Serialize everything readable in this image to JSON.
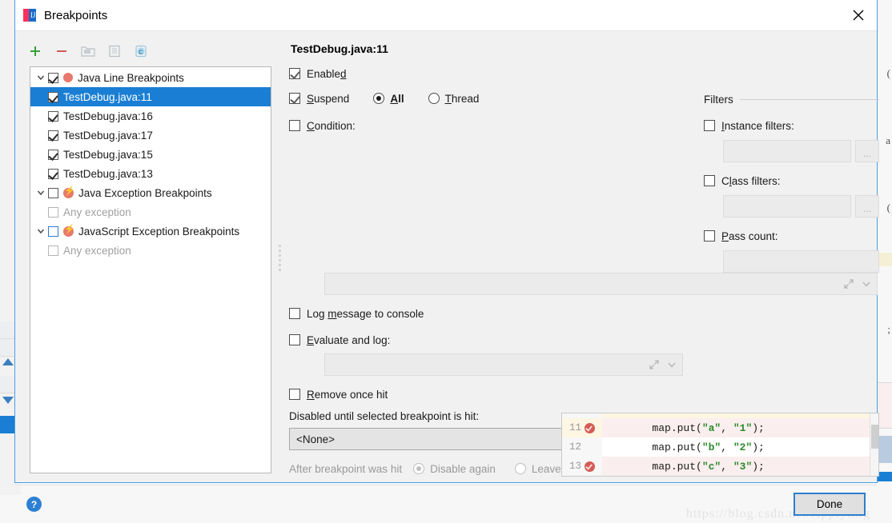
{
  "window": {
    "title": "Breakpoints",
    "app_icon": "intellij-idea-icon",
    "close_icon": "close-icon"
  },
  "toolbar": {
    "add_label": "+",
    "remove_label": "−",
    "items": [
      {
        "name": "add-breakpoint-button",
        "icon": "plus-icon",
        "enabled": true
      },
      {
        "name": "remove-breakpoint-button",
        "icon": "minus-icon",
        "enabled": true
      },
      {
        "name": "group-by-file-button",
        "icon": "folder-icon",
        "enabled": false
      },
      {
        "name": "group-by-type-button",
        "icon": "document-icon",
        "enabled": false
      },
      {
        "name": "group-by-class-button",
        "icon": "class-c-icon",
        "enabled": false
      }
    ]
  },
  "tree": {
    "nodes": [
      {
        "label": "Java Line Breakpoints",
        "level": 0,
        "checked": true,
        "icon": "breakpoint-dot-icon",
        "twisty": "expanded",
        "selected": false,
        "dim": false
      },
      {
        "label": "TestDebug.java:11",
        "level": 1,
        "checked": true,
        "icon": "none",
        "twisty": "none",
        "selected": true,
        "dim": false
      },
      {
        "label": "TestDebug.java:16",
        "level": 1,
        "checked": true,
        "icon": "none",
        "twisty": "none",
        "selected": false,
        "dim": false
      },
      {
        "label": "TestDebug.java:17",
        "level": 1,
        "checked": true,
        "icon": "none",
        "twisty": "none",
        "selected": false,
        "dim": false
      },
      {
        "label": "TestDebug.java:15",
        "level": 1,
        "checked": true,
        "icon": "none",
        "twisty": "none",
        "selected": false,
        "dim": false
      },
      {
        "label": "TestDebug.java:13",
        "level": 1,
        "checked": true,
        "icon": "none",
        "twisty": "none",
        "selected": false,
        "dim": false
      },
      {
        "label": "Java Exception Breakpoints",
        "level": 0,
        "checked": false,
        "icon": "exception-bolt-icon",
        "twisty": "expanded",
        "selected": false,
        "dim": false
      },
      {
        "label": "Any exception",
        "level": 1,
        "checked": false,
        "icon": "none",
        "twisty": "none",
        "selected": false,
        "dim": true
      },
      {
        "label": "JavaScript Exception Breakpoints",
        "level": 0,
        "checked": false,
        "icon": "exception-bolt-icon",
        "twisty": "expanded",
        "selected": false,
        "dim": false
      },
      {
        "label": "Any exception",
        "level": 1,
        "checked": false,
        "icon": "none",
        "twisty": "none",
        "selected": false,
        "dim": true
      }
    ]
  },
  "detail": {
    "title": "TestDebug.java:11",
    "enabled": {
      "label": "Enabled",
      "mnemonic": "d",
      "checked": true
    },
    "suspend": {
      "label": "Suspend",
      "mnemonic": "S",
      "checked": true
    },
    "suspend_all": {
      "label": "All",
      "mnemonic": "A",
      "selected": true
    },
    "suspend_thread": {
      "label": "Thread",
      "mnemonic": "T",
      "selected": false
    },
    "condition": {
      "label": "Condition:",
      "mnemonic": "C",
      "checked": false,
      "value": "",
      "expand_icon": "expand-icon",
      "dropdown_icon": "chevron-down-icon"
    },
    "log_message": {
      "label": "Log message to console",
      "mnemonic": "m",
      "checked": false
    },
    "evaluate_and_log": {
      "label": "Evaluate and log:",
      "mnemonic": "E",
      "checked": false,
      "value": "",
      "expand_icon": "expand-icon",
      "dropdown_icon": "chevron-down-icon"
    },
    "remove_once_hit": {
      "label": "Remove once hit",
      "mnemonic": "R",
      "checked": false
    },
    "disabled_until": {
      "label": "Disabled until selected breakpoint is hit:",
      "value": "<None>",
      "dropdown_icon": "chevron-down-icon"
    },
    "after_hit": {
      "label": "After breakpoint was hit",
      "disable_again": {
        "label": "Disable again",
        "selected": true
      },
      "leave_enabled": {
        "label": "Leave enabled",
        "selected": false
      }
    }
  },
  "filters": {
    "legend": "Filters",
    "instance": {
      "label": "Instance filters:",
      "mnemonic": "I",
      "checked": false,
      "value": "",
      "browse_label": "..."
    },
    "class": {
      "label": "Class filters:",
      "mnemonic": "l",
      "checked": false,
      "value": "",
      "browse_label": "..."
    },
    "pass_count": {
      "label": "Pass count:",
      "mnemonic": "P",
      "checked": false,
      "value": ""
    }
  },
  "code_preview": {
    "lines": [
      {
        "number": "11",
        "has_breakpoint": true,
        "highlighted": true,
        "current": true,
        "code": "        map.put(",
        "str1": "\"a\"",
        "mid": ", ",
        "str2": "\"1\"",
        "tail": ");"
      },
      {
        "number": "12",
        "has_breakpoint": false,
        "highlighted": false,
        "current": false,
        "code": "        map.put(",
        "str1": "\"b\"",
        "mid": ", ",
        "str2": "\"2\"",
        "tail": ");"
      },
      {
        "number": "13",
        "has_breakpoint": true,
        "highlighted": true,
        "current": false,
        "code": "        map.put(",
        "str1": "\"c\"",
        "mid": ", ",
        "str2": "\"3\"",
        "tail": ");"
      }
    ]
  },
  "footer": {
    "help_label": "?",
    "done_label": "Done",
    "watermark": "https://blog.csdn.net/Applyinig"
  }
}
